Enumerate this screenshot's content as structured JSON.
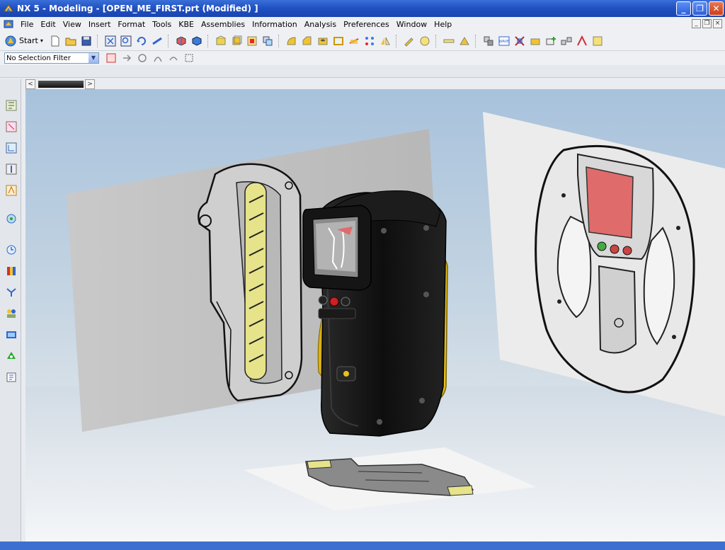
{
  "window": {
    "title": "NX 5 - Modeling - [OPEN_ME_FIRST.prt (Modified) ]",
    "minimize": "_",
    "maximize": "❐",
    "close": "✕"
  },
  "menu": {
    "items": [
      "File",
      "Edit",
      "View",
      "Insert",
      "Format",
      "Tools",
      "KBE",
      "Assemblies",
      "Information",
      "Analysis",
      "Preferences",
      "Window",
      "Help"
    ]
  },
  "toolbar": {
    "start_label": "Start",
    "selection_filter": "No Selection Filter"
  },
  "tabs": {
    "prev": "<",
    "next": ">"
  },
  "colors": {
    "titlebar": "#1f4fc1",
    "accent_yellow": "#e8c11a",
    "screen_red": "#e06b6b"
  }
}
